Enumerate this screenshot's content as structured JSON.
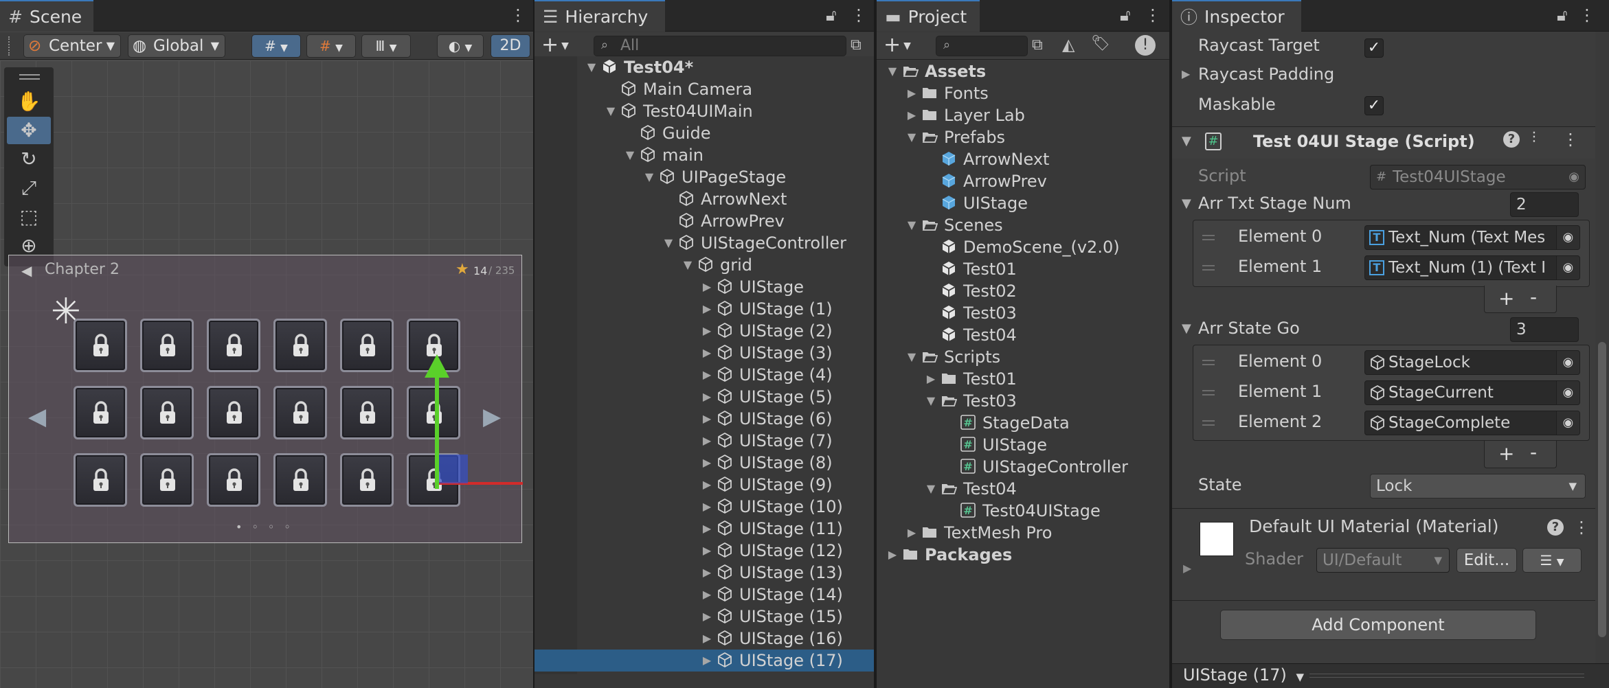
{
  "scene": {
    "tab_label": "Scene",
    "pivot_label": "Center",
    "space_label": "Global",
    "mode_2d_label": "2D",
    "canvas": {
      "chapter_title": "Chapter 2",
      "star_count": "14",
      "star_total": "/ 235"
    }
  },
  "hierarchy": {
    "tab_label": "Hierarchy",
    "search_placeholder": "All",
    "items": [
      {
        "label": "Test04*",
        "depth": 0,
        "expanded": true,
        "bold": true,
        "icon": "unity-scene-icon"
      },
      {
        "label": "Main Camera",
        "depth": 1,
        "expanded": null,
        "icon": "gameobject-icon"
      },
      {
        "label": "Test04UIMain",
        "depth": 1,
        "expanded": true,
        "icon": "gameobject-icon"
      },
      {
        "label": "Guide",
        "depth": 2,
        "expanded": null,
        "icon": "gameobject-icon"
      },
      {
        "label": "main",
        "depth": 2,
        "expanded": true,
        "icon": "gameobject-icon"
      },
      {
        "label": "UIPageStage",
        "depth": 3,
        "expanded": true,
        "icon": "gameobject-icon"
      },
      {
        "label": "ArrowNext",
        "depth": 4,
        "expanded": null,
        "icon": "gameobject-icon"
      },
      {
        "label": "ArrowPrev",
        "depth": 4,
        "expanded": null,
        "icon": "gameobject-icon"
      },
      {
        "label": "UIStageController",
        "depth": 4,
        "expanded": true,
        "icon": "gameobject-icon"
      },
      {
        "label": "grid",
        "depth": 5,
        "expanded": true,
        "icon": "gameobject-icon"
      },
      {
        "label": "UIStage",
        "depth": 6,
        "expanded": false,
        "icon": "gameobject-icon"
      },
      {
        "label": "UIStage (1)",
        "depth": 6,
        "expanded": false,
        "icon": "gameobject-icon"
      },
      {
        "label": "UIStage (2)",
        "depth": 6,
        "expanded": false,
        "icon": "gameobject-icon"
      },
      {
        "label": "UIStage (3)",
        "depth": 6,
        "expanded": false,
        "icon": "gameobject-icon"
      },
      {
        "label": "UIStage (4)",
        "depth": 6,
        "expanded": false,
        "icon": "gameobject-icon"
      },
      {
        "label": "UIStage (5)",
        "depth": 6,
        "expanded": false,
        "icon": "gameobject-icon"
      },
      {
        "label": "UIStage (6)",
        "depth": 6,
        "expanded": false,
        "icon": "gameobject-icon"
      },
      {
        "label": "UIStage (7)",
        "depth": 6,
        "expanded": false,
        "icon": "gameobject-icon"
      },
      {
        "label": "UIStage (8)",
        "depth": 6,
        "expanded": false,
        "icon": "gameobject-icon"
      },
      {
        "label": "UIStage (9)",
        "depth": 6,
        "expanded": false,
        "icon": "gameobject-icon"
      },
      {
        "label": "UIStage (10)",
        "depth": 6,
        "expanded": false,
        "icon": "gameobject-icon"
      },
      {
        "label": "UIStage (11)",
        "depth": 6,
        "expanded": false,
        "icon": "gameobject-icon"
      },
      {
        "label": "UIStage (12)",
        "depth": 6,
        "expanded": false,
        "icon": "gameobject-icon"
      },
      {
        "label": "UIStage (13)",
        "depth": 6,
        "expanded": false,
        "icon": "gameobject-icon"
      },
      {
        "label": "UIStage (14)",
        "depth": 6,
        "expanded": false,
        "icon": "gameobject-icon"
      },
      {
        "label": "UIStage (15)",
        "depth": 6,
        "expanded": false,
        "icon": "gameobject-icon"
      },
      {
        "label": "UIStage (16)",
        "depth": 6,
        "expanded": false,
        "icon": "gameobject-icon"
      },
      {
        "label": "UIStage (17)",
        "depth": 6,
        "expanded": false,
        "icon": "gameobject-icon",
        "selected": true
      }
    ]
  },
  "project": {
    "tab_label": "Project",
    "items": [
      {
        "label": "Assets",
        "depth": 0,
        "expanded": true,
        "bold": true,
        "icon": "folder-open-icon"
      },
      {
        "label": "Fonts",
        "depth": 1,
        "expanded": false,
        "icon": "folder-icon"
      },
      {
        "label": "Layer Lab",
        "depth": 1,
        "expanded": false,
        "icon": "folder-icon"
      },
      {
        "label": "Prefabs",
        "depth": 1,
        "expanded": true,
        "icon": "folder-open-icon"
      },
      {
        "label": "ArrowNext",
        "depth": 2,
        "expanded": null,
        "icon": "prefab-icon"
      },
      {
        "label": "ArrowPrev",
        "depth": 2,
        "expanded": null,
        "icon": "prefab-icon"
      },
      {
        "label": "UIStage",
        "depth": 2,
        "expanded": null,
        "icon": "prefab-icon"
      },
      {
        "label": "Scenes",
        "depth": 1,
        "expanded": true,
        "icon": "folder-open-icon"
      },
      {
        "label": "DemoScene_(v2.0)",
        "depth": 2,
        "expanded": null,
        "icon": "unity-scene-icon"
      },
      {
        "label": "Test01",
        "depth": 2,
        "expanded": null,
        "icon": "unity-scene-icon"
      },
      {
        "label": "Test02",
        "depth": 2,
        "expanded": null,
        "icon": "unity-scene-icon"
      },
      {
        "label": "Test03",
        "depth": 2,
        "expanded": null,
        "icon": "unity-scene-icon"
      },
      {
        "label": "Test04",
        "depth": 2,
        "expanded": null,
        "icon": "unity-scene-icon"
      },
      {
        "label": "Scripts",
        "depth": 1,
        "expanded": true,
        "icon": "folder-open-icon"
      },
      {
        "label": "Test01",
        "depth": 2,
        "expanded": false,
        "icon": "folder-icon"
      },
      {
        "label": "Test03",
        "depth": 2,
        "expanded": true,
        "icon": "folder-open-icon"
      },
      {
        "label": "StageData",
        "depth": 3,
        "expanded": null,
        "icon": "script-icon"
      },
      {
        "label": "UIStage",
        "depth": 3,
        "expanded": null,
        "icon": "script-icon"
      },
      {
        "label": "UIStageController",
        "depth": 3,
        "expanded": null,
        "icon": "script-icon"
      },
      {
        "label": "Test04",
        "depth": 2,
        "expanded": true,
        "icon": "folder-open-icon"
      },
      {
        "label": "Test04UIStage",
        "depth": 3,
        "expanded": null,
        "icon": "script-icon"
      },
      {
        "label": "TextMesh Pro",
        "depth": 1,
        "expanded": false,
        "icon": "folder-icon"
      },
      {
        "label": "Packages",
        "depth": 0,
        "expanded": false,
        "bold": true,
        "icon": "folder-icon"
      }
    ]
  },
  "inspector": {
    "tab_label": "Inspector",
    "raycast_target_label": "Raycast Target",
    "raycast_padding_label": "Raycast Padding",
    "maskable_label": "Maskable",
    "check_mark": "✓",
    "component_title": "Test 04UI Stage (Script)",
    "script_label": "Script",
    "script_value": "Test04UIStage",
    "arr_txt_label": "Arr Txt Stage Num",
    "arr_txt_count": "2",
    "arr_txt_elements": [
      {
        "label": "Element 0",
        "value": "Text_Num (Text Mes"
      },
      {
        "label": "Element 1",
        "value": "Text_Num (1) (Text I"
      }
    ],
    "arr_state_label": "Arr State Go",
    "arr_state_count": "3",
    "arr_state_elements": [
      {
        "label": "Element 0",
        "value": "StageLock"
      },
      {
        "label": "Element 1",
        "value": "StageCurrent"
      },
      {
        "label": "Element 2",
        "value": "StageComplete"
      }
    ],
    "plus": "+",
    "minus": "-",
    "state_label": "State",
    "state_value": "Lock",
    "material_title": "Default UI Material (Material)",
    "shader_label": "Shader",
    "shader_value": "UI/Default",
    "edit_label": "Edit...",
    "add_component_label": "Add Component",
    "footer_selected": "UIStage (17)"
  }
}
